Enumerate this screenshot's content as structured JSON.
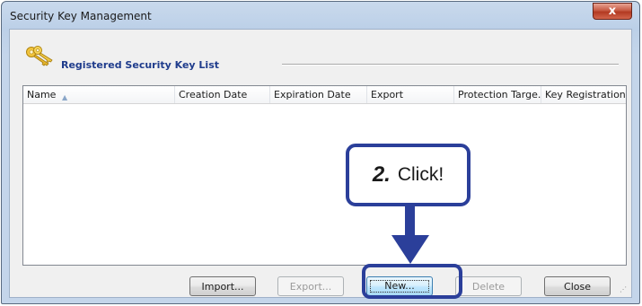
{
  "window": {
    "title": "Security Key Management",
    "close_label": "x"
  },
  "section": {
    "title": "Registered Security Key List"
  },
  "list": {
    "columns": [
      "Name",
      "Creation Date",
      "Expiration Date",
      "Export",
      "Protection Targe...",
      "Key Registration..."
    ],
    "sorted_column": "Name",
    "sort_direction": "ascending",
    "rows": []
  },
  "buttons": {
    "import": "Import...",
    "export": "Export...",
    "new": "New...",
    "delete": "Delete",
    "close": "Close"
  },
  "annotation": {
    "step": "2.",
    "text": "Click!"
  },
  "colors": {
    "annotation": "#2b3f9a",
    "section_title": "#1f3c8c",
    "close_button": "#c75a43"
  },
  "icons": {
    "section": "keys-icon",
    "sort": "sort-ascending-icon",
    "close": "close-icon"
  }
}
